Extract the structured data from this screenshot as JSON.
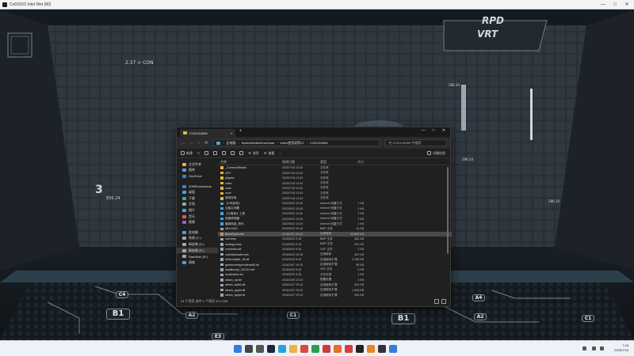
{
  "game_window": {
    "title": "CoD2/2/2  Intel Wet (80)",
    "controls": [
      "—",
      "□",
      "✕"
    ]
  },
  "hud": {
    "badge_top_right_1": "RPD",
    "badge_top_right_2": "VRT",
    "label_left": "2.37 > CON",
    "readout_1": "836.24",
    "readout_2": "286.34",
    "readout_3": "286.34",
    "readout_4": "286.34",
    "big_digit": "3",
    "floor_labels": [
      "B1",
      "A2",
      "E3",
      "C1",
      "B1",
      "A2",
      "C1",
      "C4",
      "A4"
    ]
  },
  "explorer": {
    "tab_title": "COD12A066",
    "new_tab": "+",
    "window_controls": [
      "—",
      "□",
      "✕"
    ],
    "nav": {
      "back": "←",
      "forward": "→",
      "up": "↑",
      "refresh": "⟳"
    },
    "address": [
      "此电脑",
      "BaiduNetdiskDownload",
      "index使用说明12",
      "COD12A066"
    ],
    "search_placeholder": "在 COD12A066 中搜索",
    "toolbar": {
      "new": "新建",
      "sort": "排序",
      "view": "查看",
      "more": "···",
      "details": "详细信息"
    },
    "sidebar": [
      {
        "label": "主文件夹",
        "color": "#e8b53e"
      },
      {
        "label": "图库",
        "color": "#4aa3df"
      },
      {
        "label": "OneDrive",
        "color": "#3c82d8"
      },
      {
        "label": "",
        "color": ""
      },
      {
        "label": "2085Downloads",
        "color": "#3c82d8"
      },
      {
        "label": "桌面",
        "color": "#4aa3df"
      },
      {
        "label": "下载",
        "color": "#3cb371"
      },
      {
        "label": "文档",
        "color": "#9aa7b3"
      },
      {
        "label": "图片",
        "color": "#4aa3df"
      },
      {
        "label": "音乐",
        "color": "#e05a5a"
      },
      {
        "label": "视频",
        "color": "#9d5ad9"
      },
      {
        "label": "",
        "color": ""
      },
      {
        "label": "此电脑",
        "color": "#4aa3df"
      },
      {
        "label": "系统 (C:)",
        "color": "#9aa7b3"
      },
      {
        "label": "新加卷 (D:)",
        "color": "#9aa7b3"
      },
      {
        "label": "新加卷 (E:)",
        "color": "#9aa7b3"
      },
      {
        "label": "RamDisk (R:)",
        "color": "#9aa7b3"
      },
      {
        "label": "网络",
        "color": "#4aa3df"
      }
    ],
    "columns": {
      "name": "名称",
      "date": "修改日期",
      "type": "类型",
      "size": "大小"
    },
    "files": [
      {
        "name": "_CommonRedist",
        "date": "2025/7/18 13:43",
        "type": "文件夹",
        "size": "",
        "icon": "#e8b53e"
      },
      {
        "name": "UPC",
        "date": "2025/7/18 13:43",
        "type": "文件夹",
        "size": "",
        "icon": "#e8b53e"
      },
      {
        "name": "players",
        "date": "2025/7/18 13:43",
        "type": "文件夹",
        "size": "",
        "icon": "#e8b53e"
      },
      {
        "name": "video",
        "date": "2025/7/18 13:43",
        "type": "文件夹",
        "size": "",
        "icon": "#e8b53e"
      },
      {
        "name": "zone",
        "date": "2025/7/18 13:43",
        "type": "文件夹",
        "size": "",
        "icon": "#e8b53e"
      },
      {
        "name": "zone",
        "date": "2025/7/18 13:43",
        "type": "文件夹",
        "size": "",
        "icon": "#e8b53e"
      },
      {
        "name": "游戏存档",
        "date": "2025/7/18 13:43",
        "type": "文件夹",
        "size": "",
        "icon": "#e8b53e"
      },
      {
        "name": "【1号游戏】",
        "date": "2022/5/22 10:40",
        "type": "Internet 快捷方式",
        "size": "1 KB",
        "icon": "#4aa3df"
      },
      {
        "name": "云客云问题",
        "date": "2022/5/22 10:40",
        "type": "Internet 快捷方式",
        "size": "1 KB",
        "icon": "#4aa3df"
      },
      {
        "name": "【小程序】工具",
        "date": "2022/5/22 10:40",
        "type": "Internet 快捷方式",
        "size": "1 KB",
        "icon": "#4aa3df"
      },
      {
        "name": "免费修改器",
        "date": "2022/5/22 10:40",
        "type": "Internet 快捷方式",
        "size": "1 KB",
        "icon": "#4aa3df"
      },
      {
        "name": "最新网游_资讯",
        "date": "2022/5/22 10:40",
        "type": "Internet 快捷方式",
        "size": "1 KB",
        "icon": "#4aa3df"
      },
      {
        "name": "sBX1X4H",
        "date": "2016/5/20 19:18",
        "type": "BMP 文件",
        "size": "15 KB",
        "icon": "#9aa7b3"
      },
      {
        "name": "BlackOps3.exe",
        "date": "2016/10/7 20:16",
        "type": "应用程序",
        "size": "32,800 KB",
        "icon": "#d9883a"
      },
      {
        "name": "cod.bmp",
        "date": "2016/5/20 9:18",
        "type": "BMP 文件",
        "size": "481 KB",
        "icon": "#9aa7b3"
      },
      {
        "name": "codlogo.bmp",
        "date": "2016/5/20 9:18",
        "type": "BMP 文件",
        "size": "391 KB",
        "icon": "#9aa7b3"
      },
      {
        "name": "controller.cdf",
        "date": "2016/5/20 9:18",
        "type": "CDF 文件",
        "size": "2 KB",
        "icon": "#9aa7b3"
      },
      {
        "name": "crashUploader.exe",
        "date": "2016/5/20 19:18",
        "type": "应用程序",
        "size": "421 KB",
        "icon": "#9aa7b3"
      },
      {
        "name": "d3dcompiler_46.dll",
        "date": "2016/5/20 9:18",
        "type": "应用程序扩展",
        "size": "3,765 KB",
        "icon": "#9aa7b3"
      },
      {
        "name": "gameoverlayrenderer64.dll",
        "date": "2016/10/7 19:10",
        "type": "应用程序扩展",
        "size": "98 KB",
        "icon": "#9aa7b3"
      },
      {
        "name": "installscript_311210.vdf",
        "date": "2016/5/20 9:18",
        "type": "VDF 文件",
        "size": "2 KB",
        "icon": "#9aa7b3"
      },
      {
        "name": "localization.txt",
        "date": "2016/5/20 9:18",
        "type": "文本文档",
        "size": "1 KB",
        "icon": "#9aa7b3"
      },
      {
        "name": "steam_api.ini",
        "date": "2016/10/6 12:23",
        "type": "配置设置",
        "size": "1 KB",
        "icon": "#9aa7b3"
      },
      {
        "name": "steam_api64.dll",
        "date": "2016/10/7 19:10",
        "type": "应用程序扩展",
        "size": "254 KB",
        "icon": "#9aa7b3"
      },
      {
        "name": "steam_appid.dll",
        "date": "2016/10/7 19:10",
        "type": "应用程序扩展",
        "size": "1,490 KB",
        "icon": "#9aa7b3"
      },
      {
        "name": "steam_appid.txt",
        "date": "2016/10/7 19:10",
        "type": "应用程序扩展",
        "size": "254 KB",
        "icon": "#9aa7b3"
      },
      {
        "name": "steamDRM.exe",
        "date": "2016/9/28 18:23",
        "type": "WOW 文件",
        "size": "234 KB",
        "icon": "#9aa7b3"
      }
    ],
    "status": "24 个项目   选中 1 个项目 32.0 MB"
  },
  "taskbar": {
    "icons": [
      {
        "name": "start",
        "color": "#2f7fe0"
      },
      {
        "name": "search",
        "color": "#444444"
      },
      {
        "name": "task-view",
        "color": "#555555"
      },
      {
        "name": "steam",
        "color": "#1b2838"
      },
      {
        "name": "edge",
        "color": "#2aa2d8"
      },
      {
        "name": "files",
        "color": "#e8b53e"
      },
      {
        "name": "chrome",
        "color": "#d94a3a"
      },
      {
        "name": "app-green",
        "color": "#2e9b55"
      },
      {
        "name": "app-red",
        "color": "#cf3a3a"
      },
      {
        "name": "app-orange",
        "color": "#e0702b"
      },
      {
        "name": "app-red-2",
        "color": "#d83c3c"
      },
      {
        "name": "game-active",
        "color": "#222222"
      },
      {
        "name": "app-orange-2",
        "color": "#e9862a"
      },
      {
        "name": "app-dark",
        "color": "#333333"
      },
      {
        "name": "app-blue",
        "color": "#3a7ad8"
      }
    ],
    "time": "7:43",
    "date": "2025/7/18"
  }
}
